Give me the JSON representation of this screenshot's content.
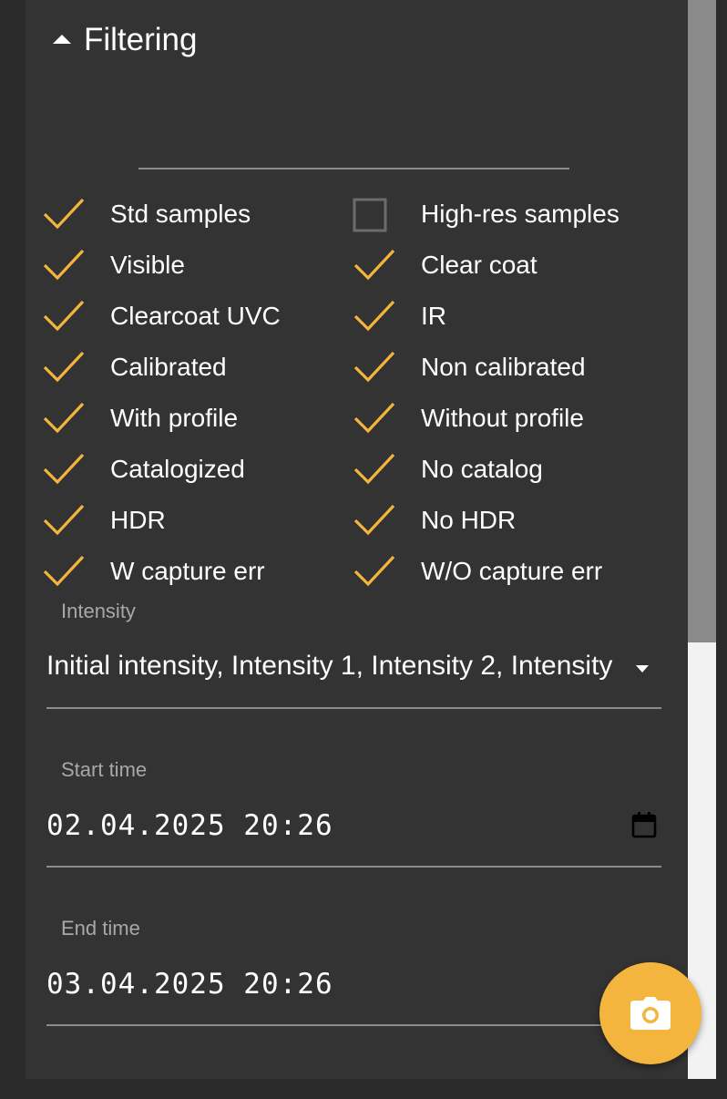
{
  "section": {
    "title": "Filtering"
  },
  "colors": {
    "accent": "#f4b53e",
    "panel": "#333333",
    "check": "#f4b53e"
  },
  "checkboxes": [
    {
      "label": "Std samples",
      "checked": true
    },
    {
      "label": "High-res samples",
      "checked": false
    },
    {
      "label": "Visible",
      "checked": true
    },
    {
      "label": "Clear coat",
      "checked": true
    },
    {
      "label": "Clearcoat UVC",
      "checked": true
    },
    {
      "label": "IR",
      "checked": true
    },
    {
      "label": "Calibrated",
      "checked": true
    },
    {
      "label": "Non calibrated",
      "checked": true
    },
    {
      "label": "With profile",
      "checked": true
    },
    {
      "label": "Without profile",
      "checked": true
    },
    {
      "label": "Catalogized",
      "checked": true
    },
    {
      "label": "No catalog",
      "checked": true
    },
    {
      "label": "HDR",
      "checked": true
    },
    {
      "label": "No HDR",
      "checked": true
    },
    {
      "label": "W capture err",
      "checked": true
    },
    {
      "label": "W/O capture err",
      "checked": true
    }
  ],
  "intensity": {
    "label": "Intensity",
    "value": "Initial intensity, Intensity 1, Intensity 2, Intensity"
  },
  "start_time": {
    "label": "Start time",
    "value": "02.04.2025 20:26"
  },
  "end_time": {
    "label": "End time",
    "value": "03.04.2025 20:26"
  },
  "icons": {
    "fab": "camera-icon",
    "calendar": "calendar-icon",
    "header": "caret-up-icon"
  }
}
